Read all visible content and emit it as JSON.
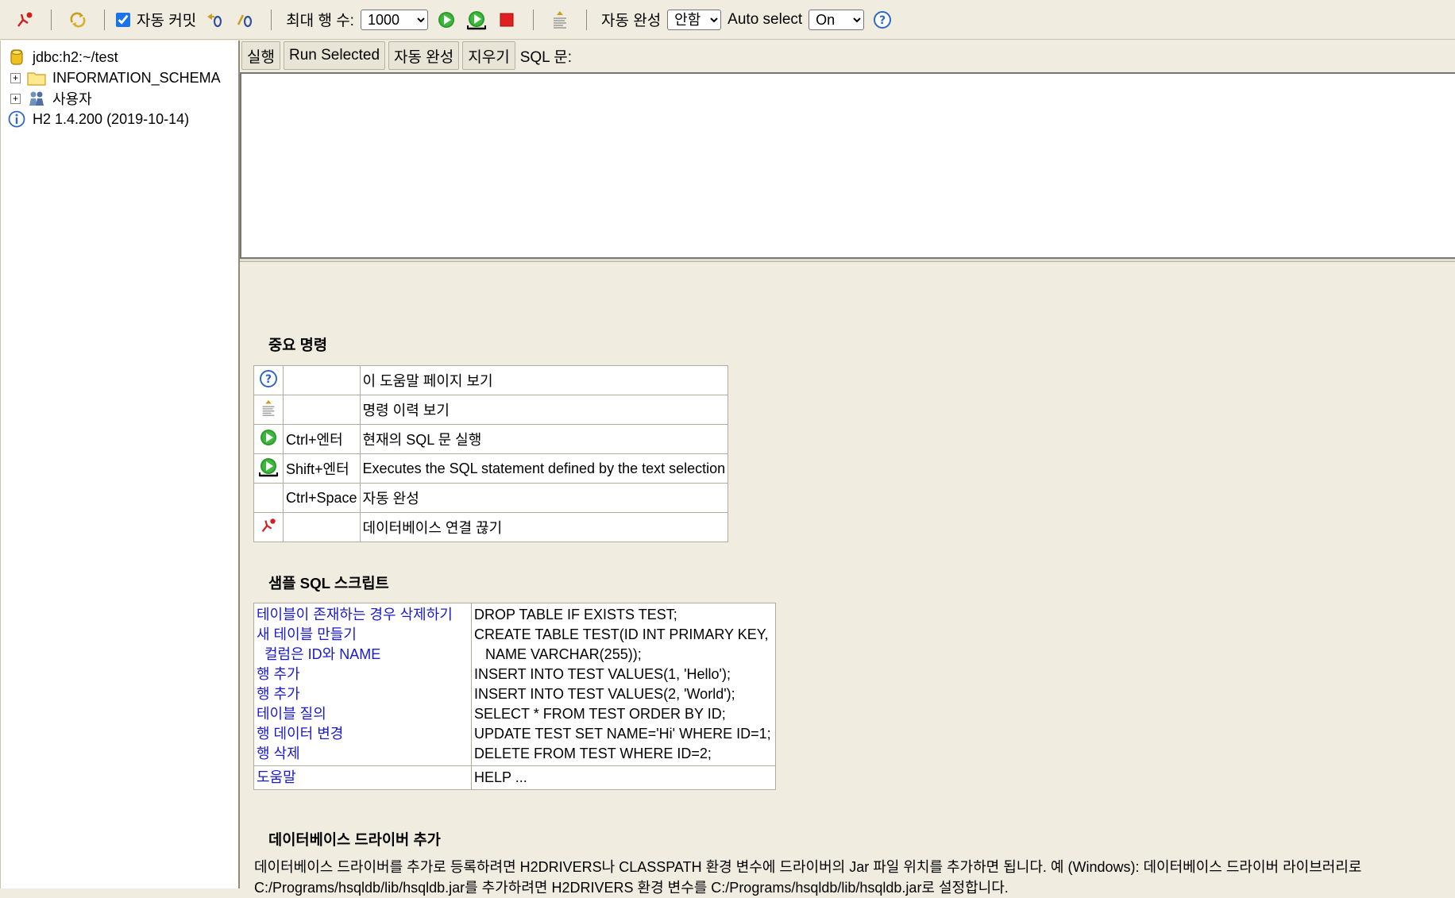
{
  "toolbar": {
    "autocommit_label": "자동 커밋",
    "max_rows_label": "최대 행 수:",
    "max_rows_value": "1000",
    "autocomplete_label": "자동 완성",
    "autocomplete_value": "안함",
    "autoselect_label": "Auto select",
    "autoselect_value": "On"
  },
  "tree": {
    "connection": "jdbc:h2:~/test",
    "items": [
      {
        "label": "INFORMATION_SCHEMA"
      },
      {
        "label": "사용자"
      }
    ],
    "version": "H2 1.4.200 (2019-10-14)"
  },
  "sql": {
    "run_label": "실행",
    "run_selected_label": "Run Selected",
    "autocomplete_label": "자동 완성",
    "clear_label": "지우기",
    "statement_label": "SQL 문:"
  },
  "help": {
    "important_title": "중요 명령",
    "commands": [
      {
        "icon": "help-icon",
        "key": "",
        "desc": "이 도움말 페이지 보기"
      },
      {
        "icon": "history-icon",
        "key": "",
        "desc": "명령 이력 보기"
      },
      {
        "icon": "run-icon",
        "key": "Ctrl+엔터",
        "desc": "현재의 SQL 문 실행"
      },
      {
        "icon": "run-selected-icon",
        "key": "Shift+엔터",
        "desc": "Executes the SQL statement defined by the text selection"
      },
      {
        "icon": "",
        "key": "Ctrl+Space",
        "desc": "자동 완성"
      },
      {
        "icon": "disconnect-icon",
        "key": "",
        "desc": "데이터베이스 연결 끊기"
      }
    ],
    "sample_title": "샘플 SQL 스크립트",
    "samples": [
      {
        "label": "테이블이 존재하는 경우 삭제하기",
        "sql": "DROP TABLE IF EXISTS TEST;"
      },
      {
        "label": "새 테이블 만들기",
        "sql": "CREATE TABLE TEST(ID INT PRIMARY KEY,"
      },
      {
        "label": "컬럼은 ID와 NAME",
        "sql": "NAME VARCHAR(255));"
      },
      {
        "label": "행 추가",
        "sql": "INSERT INTO TEST VALUES(1, 'Hello');"
      },
      {
        "label": "행 추가",
        "sql": "INSERT INTO TEST VALUES(2, 'World');"
      },
      {
        "label": "테이블 질의",
        "sql": "SELECT * FROM TEST ORDER BY ID;"
      },
      {
        "label": "행 데이터 변경",
        "sql": "UPDATE TEST SET NAME='Hi' WHERE ID=1;"
      },
      {
        "label": "행 삭제",
        "sql": "DELETE FROM TEST WHERE ID=2;"
      }
    ],
    "help_label": "도움말",
    "help_sql": "HELP ...",
    "driver_title": "데이터베이스 드라이버 추가",
    "driver_text": "데이터베이스 드라이버를 추가로 등록하려면 H2DRIVERS나 CLASSPATH 환경 변수에 드라이버의 Jar 파일 위치를 추가하면 됩니다. 예 (Windows): 데이터베이스 드라이버 라이브러리로 C:/Programs/hsqldb/lib/hsqldb.jar를 추가하려면 H2DRIVERS 환경 변수를 C:/Programs/hsqldb/lib/hsqldb.jar로 설정합니다."
  },
  "colors": {
    "background": "#f0ede0",
    "link": "#1a1acf",
    "run_green": "#2e9a2e",
    "stop_red": "#e02020"
  }
}
